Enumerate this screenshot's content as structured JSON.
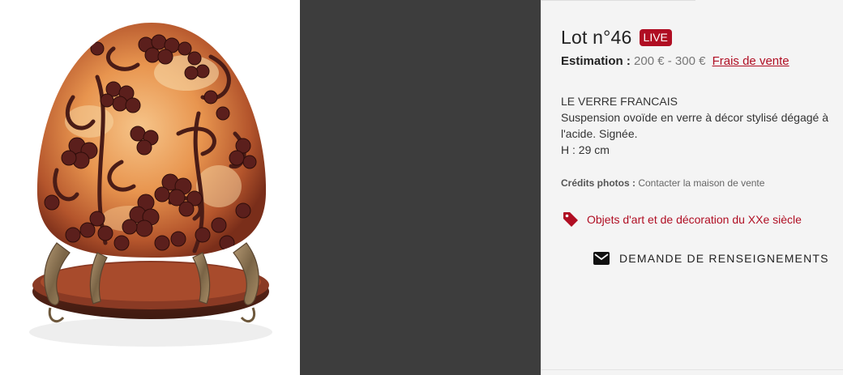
{
  "lot": {
    "title": "Lot n°46",
    "badge": "LIVE"
  },
  "estimate": {
    "label": "Estimation :",
    "value": "200 € - 300 €",
    "fees_link": "Frais de vente"
  },
  "description": {
    "maker": "LE VERRE FRANCAIS",
    "text": "Suspension ovoïde en verre à décor stylisé dégagé à l'acide. Signée.",
    "dimension": "H : 29 cm"
  },
  "credits": {
    "label": "Crédits photos :",
    "value": "Contacter la maison de vente"
  },
  "category": {
    "label": "Objets d'art et de décoration du XXe siècle",
    "icon": "tag-icon"
  },
  "inquiry": {
    "label": "DEMANDE DE RENSEIGNEMENTS",
    "icon": "mail-icon"
  },
  "colors": {
    "accent": "#b00e23",
    "dark_panel": "#3d3d3d",
    "info_background": "#f4f4f4"
  }
}
